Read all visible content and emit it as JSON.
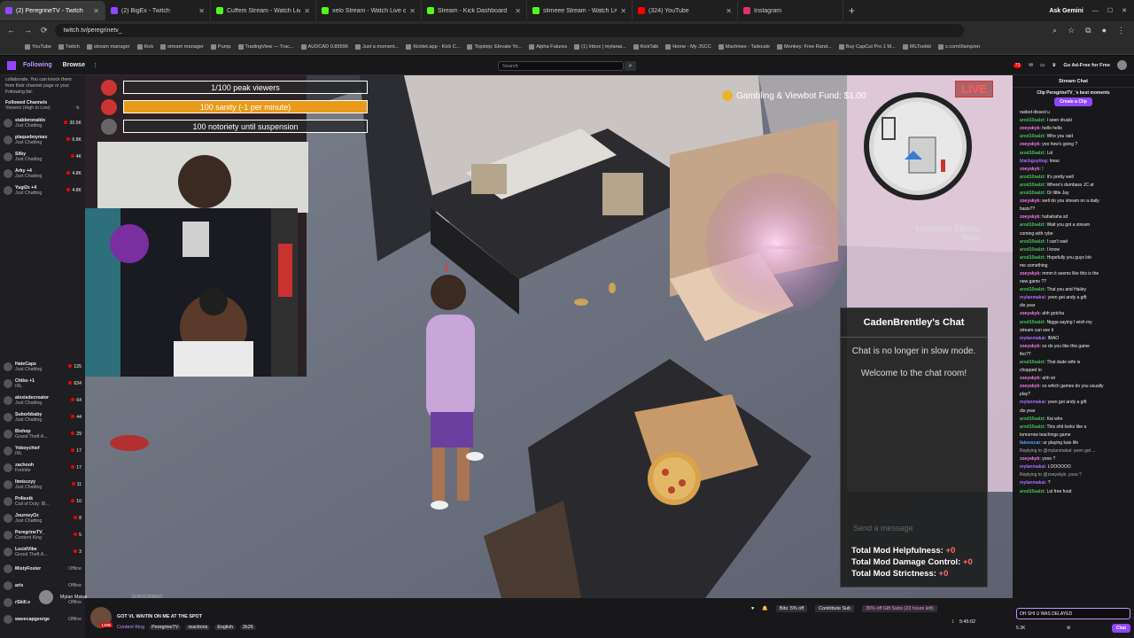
{
  "browser": {
    "tabs": [
      {
        "label": "(2) PeregrineTV - Twitch",
        "color": "#9147ff",
        "active": true
      },
      {
        "label": "(2) BigEx - Twitch",
        "color": "#9147ff",
        "active": false
      },
      {
        "label": "Cuffem Stream - Watch Live on",
        "color": "#53fc18",
        "active": false
      },
      {
        "label": "xelo Stream - Watch Live on Ki",
        "color": "#53fc18",
        "active": false
      },
      {
        "label": "Stream - Kick Dashboard",
        "color": "#53fc18",
        "active": false
      },
      {
        "label": "slimeee Stream - Watch Live on",
        "color": "#53fc18",
        "active": false
      },
      {
        "label": "(324) YouTube",
        "color": "#ff0000",
        "active": false
      },
      {
        "label": "Instagram",
        "color": "#e1306c",
        "active": false
      }
    ],
    "ask_gemini": "Ask Gemini",
    "url": "twitch.tv/peregrinetv_",
    "bookmarks": [
      "YouTube",
      "Twitch",
      "stream manager",
      "Kick",
      "stream manager",
      "Pump",
      "TradingView — Trac...",
      "AUDCAD 0.89596",
      "Just a moment...",
      "Kicklet.app - Kick C...",
      "Topstep: Elevate Yo...",
      "Alpha Futures",
      "(1) Inbox | mylanai...",
      "KickTalk",
      "Home - My JSCC",
      "Machines - Tailscale",
      "Monkey: Free Rand...",
      "Buy CapCut Pro 1 M...",
      "IRLToolkit",
      "x.com/i/lamp/en"
    ]
  },
  "twitch": {
    "following": "Following",
    "browse": "Browse",
    "search_placeholder": "Search",
    "adfree": "Go Ad-Free for Free",
    "notif_count": "72"
  },
  "sidebar": {
    "note": "collaborate. You can knock them from their channel page or your Following list.",
    "header": "Followed Channels",
    "sort": "Viewers (High to Low)",
    "channels_top": [
      {
        "name": "stableronaldo",
        "game": "Just Chatting",
        "viewers": "30.5K"
      },
      {
        "name": "plaqueboymax",
        "game": "Just Chatting",
        "viewers": "6.8K"
      },
      {
        "name": "Silky",
        "game": "Just Chatting",
        "viewers": "4K"
      },
      {
        "name": "Arky +4",
        "game": "Just Chatting",
        "viewers": "4.8K"
      },
      {
        "name": "Yugi2x +4",
        "game": "Just Chatting",
        "viewers": "4.8K"
      }
    ],
    "channels_bottom": [
      {
        "name": "HateCaps",
        "game": "Just Chatting",
        "viewers": "125"
      },
      {
        "name": "Chibu +1",
        "game": "IRL",
        "viewers": "634"
      },
      {
        "name": "alexisdecreator",
        "game": "Just Chatting",
        "viewers": "64"
      },
      {
        "name": "Suborbbaby",
        "game": "Just Chatting",
        "viewers": "44"
      },
      {
        "name": "Bishop",
        "game": "Grand Theft A...",
        "viewers": "29"
      },
      {
        "name": "Yoboychief",
        "game": "IRL",
        "viewers": "17"
      },
      {
        "name": "zachooh",
        "game": "Fortnite",
        "viewers": "17"
      },
      {
        "name": "limtezzyy",
        "game": "Just Chatting",
        "viewers": "11"
      },
      {
        "name": "Pr4isetk",
        "game": "Call of Duty: Bl...",
        "viewers": "10"
      },
      {
        "name": "JourneyOz",
        "game": "Just Chatting",
        "viewers": "8"
      },
      {
        "name": "PeregrineTV_",
        "game": "Content King",
        "viewers": "5"
      },
      {
        "name": "LucidVibe",
        "game": "Grand Theft A...",
        "viewers": "3"
      },
      {
        "name": "MistyFoster",
        "game": "",
        "viewers": "Offline"
      },
      {
        "name": "aris",
        "game": "",
        "viewers": "Offline"
      },
      {
        "name": "rSkill.x",
        "game": "",
        "viewers": "Offline"
      },
      {
        "name": "wavecapgeorge",
        "game": "",
        "viewers": "Offline"
      }
    ]
  },
  "game": {
    "hud": [
      "1/100 peak viewers",
      "100 sanity (-1 per minute)",
      "100 notoriety until suspension"
    ],
    "live": "LIVE",
    "gambling": "Gambling & Viewbot Fund: $1.00",
    "mod_effects_label": "Moderator Effects:",
    "mod_effects_value": "None",
    "player_count": "1",
    "overhead": "mylanmakai @zoeyskyk...",
    "popup": {
      "title": "CadenBrentley's Chat",
      "line1": "Chat is no longer in slow mode.",
      "line2": "Welcome to the chat room!",
      "input_placeholder": "Send a message",
      "stat1_label": "Total Mod Helpfulness:",
      "stat1_value": "+0",
      "stat2_label": "Total Mod Damage Control:",
      "stat2_value": "+0",
      "stat3_label": "Total Mod Strictness:",
      "stat3_value": "+0"
    }
  },
  "alert": {
    "name": "Mylan Makai",
    "label": "SUBSCRIBED"
  },
  "stream_info": {
    "title": "GOT VL WAITIN ON ME AT THE SPOT",
    "channel": "PeregrineTV_",
    "live": "LIVE",
    "category": "Content King",
    "tags": [
      "PeregrineTV",
      "reactions",
      "English",
      "2k26"
    ],
    "bits": "Bits: 5% off",
    "contribute": "Contribute Sub",
    "gift": "35% off Gift Subs (23 hours left)",
    "viewers": "1",
    "uptime": "5:45:02"
  },
  "chat": {
    "title": "Stream Chat",
    "clip_title": "Clip PeregrineTV_'s best moments",
    "clip_button": "Create a Clip",
    "messages": [
      {
        "user": "",
        "text": "raided dissed u",
        "color": "#efeff1"
      },
      {
        "user": "arod10salzt:",
        "text": "I seen druski",
        "color": "#45c45a"
      },
      {
        "user": "zoeyskyk:",
        "text": "hello hello",
        "color": "#ff7af0"
      },
      {
        "user": "arod10salzt:",
        "text": "Who you raid",
        "color": "#45c45a"
      },
      {
        "user": "zoeyskyk:",
        "text": "yoo how's going ?",
        "color": "#ff7af0"
      },
      {
        "user": "arod10salzt:",
        "text": "Lol",
        "color": "#45c45a"
      },
      {
        "user": "blackguyitug:",
        "text": "lmao",
        "color": "#b06bff"
      },
      {
        "user": "zoeyskyk:",
        "text": "!",
        "color": "#ff7af0"
      },
      {
        "user": "arod10salzt:",
        "text": "It's pretty well",
        "color": "#45c45a"
      },
      {
        "user": "arod10salzt:",
        "text": "Where's dumbass JC at",
        "color": "#45c45a"
      },
      {
        "user": "arod10salzt:",
        "text": "Or little Jay",
        "color": "#45c45a"
      },
      {
        "user": "zoeyskyk:",
        "text": "well do you stream on a daily",
        "color": "#ff7af0"
      },
      {
        "user": "",
        "text": "basis??",
        "color": "#efeff1"
      },
      {
        "user": "zoeyskyk:",
        "text": "hahahaha xd",
        "color": "#ff7af0"
      },
      {
        "user": "arod10salzt:",
        "text": "Wait you got a stream",
        "color": "#45c45a"
      },
      {
        "user": "",
        "text": "coming with rybe",
        "color": "#efeff1"
      },
      {
        "user": "arod10salzt:",
        "text": "I can't wait",
        "color": "#45c45a"
      },
      {
        "user": "arod10salzt:",
        "text": "I know",
        "color": "#45c45a"
      },
      {
        "user": "arod10salzt:",
        "text": "Hopefully you guys lob",
        "color": "#45c45a"
      },
      {
        "user": "",
        "text": "me something",
        "color": "#efeff1"
      },
      {
        "user": "zoeyskyk:",
        "text": "mmm it seems like this is the",
        "color": "#ff7af0"
      },
      {
        "user": "",
        "text": "new game ??",
        "color": "#efeff1"
      },
      {
        "user": "arod10salzt:",
        "text": "That you and Hailey",
        "color": "#45c45a"
      },
      {
        "user": "mylanmakai:",
        "text": "yeen get andy a gift",
        "color": "#b06bff"
      },
      {
        "user": "",
        "text": "dis year",
        "color": "#efeff1"
      },
      {
        "user": "zoeyskyk:",
        "text": "ahh gotcha",
        "color": "#ff7af0"
      },
      {
        "user": "arod10salzt:",
        "text": "Nigga saying I wish my",
        "color": "#45c45a"
      },
      {
        "user": "",
        "text": "stream can see it",
        "color": "#efeff1"
      },
      {
        "user": "mylanmakai:",
        "text": "lMAO",
        "color": "#b06bff"
      },
      {
        "user": "zoeyskyk:",
        "text": "so do you like this game",
        "color": "#ff7af0"
      },
      {
        "user": "",
        "text": "tho??",
        "color": "#efeff1"
      },
      {
        "user": "arod10salzt:",
        "text": "That dude wife is",
        "color": "#45c45a"
      },
      {
        "user": "",
        "text": "chopped to",
        "color": "#efeff1"
      },
      {
        "user": "zoeyskyk:",
        "text": "ahh sir",
        "color": "#ff7af0"
      },
      {
        "user": "zoeyskyk:",
        "text": "so which games do you usually",
        "color": "#ff7af0"
      },
      {
        "user": "",
        "text": "play?",
        "color": "#efeff1"
      },
      {
        "user": "mylanmakai:",
        "text": "yeen get andy a gift",
        "color": "#b06bff"
      },
      {
        "user": "",
        "text": "dis year",
        "color": "#efeff1"
      },
      {
        "user": "arod10salzt:",
        "text": "Kai who",
        "color": "#45c45a"
      },
      {
        "user": "arod10salzt:",
        "text": "This shit looks like a",
        "color": "#45c45a"
      },
      {
        "user": "",
        "text": "tomorrow teachings game",
        "color": "#efeff1"
      },
      {
        "user": "fakeoscar:",
        "text": "ur playing kais life",
        "color": "#4da6ff"
      },
      {
        "user": "",
        "text": "Replying to @mylanmakai: yeen get ...",
        "color": "#adadb8"
      },
      {
        "user": "zoeyskyk:",
        "text": "yooo ?",
        "color": "#ff7af0"
      },
      {
        "user": "mylanmakai:",
        "text": "LOOOOOO",
        "color": "#b06bff"
      },
      {
        "user": "",
        "text": "Replying to @zoeyskyk: yooo ?",
        "color": "#adadb8"
      },
      {
        "user": "mylanmakai:",
        "text": "?",
        "color": "#b06bff"
      },
      {
        "user": "arod10salzt:",
        "text": "Lol free food",
        "color": "#45c45a"
      }
    ],
    "input_value": "OH SHI U WAS DELAYED",
    "points": "5.3K",
    "chat_button": "Chat"
  }
}
